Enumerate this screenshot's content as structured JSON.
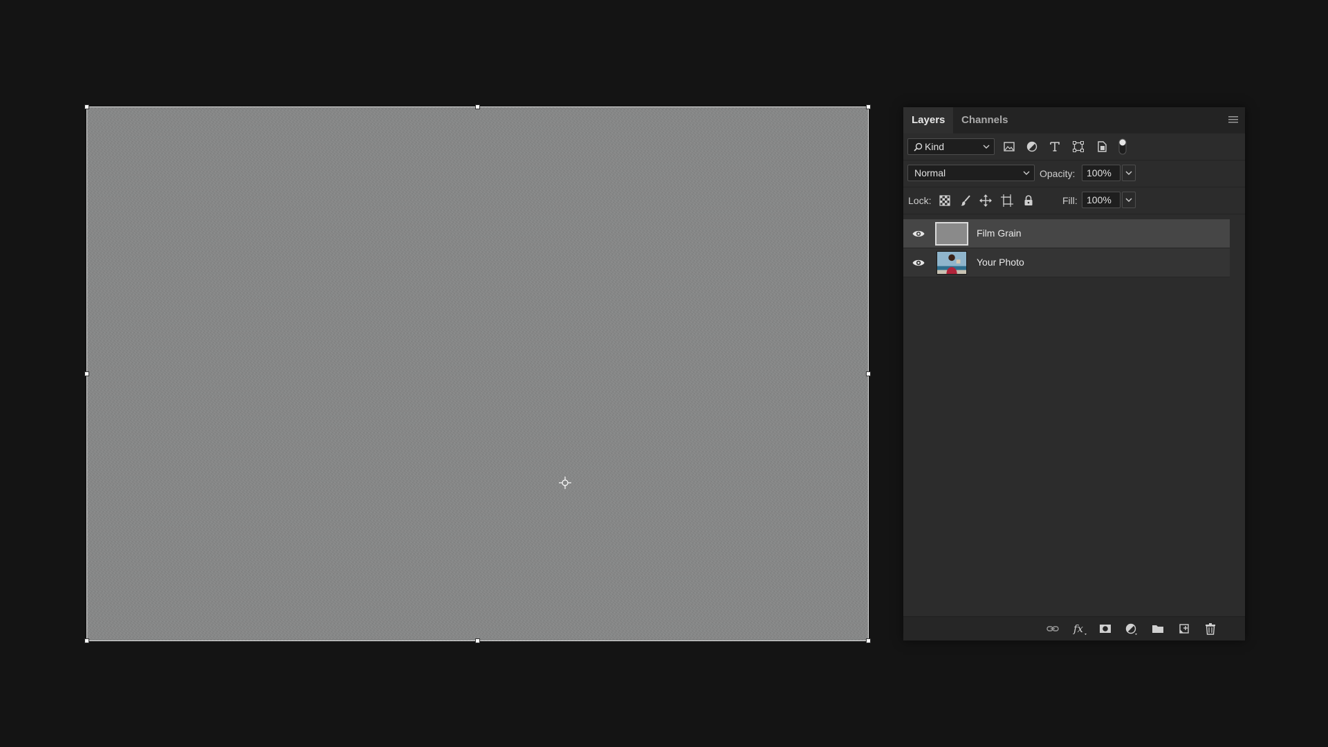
{
  "panel": {
    "tabs": {
      "layers": "Layers",
      "channels": "Channels"
    },
    "filter": {
      "label": "Kind"
    },
    "blend_mode": "Normal",
    "opacity": {
      "label": "Opacity:",
      "value": "100%"
    },
    "lock": {
      "label": "Lock:"
    },
    "fill": {
      "label": "Fill:",
      "value": "100%"
    },
    "layers": [
      {
        "name": "Film Grain",
        "visible": true,
        "selected": true
      },
      {
        "name": "Your Photo",
        "visible": true,
        "selected": false
      }
    ]
  },
  "colors": {
    "canvas": "#858686",
    "panel_bg": "#2c2c2c",
    "selected_layer": "#464646",
    "app_bg": "#141414"
  }
}
